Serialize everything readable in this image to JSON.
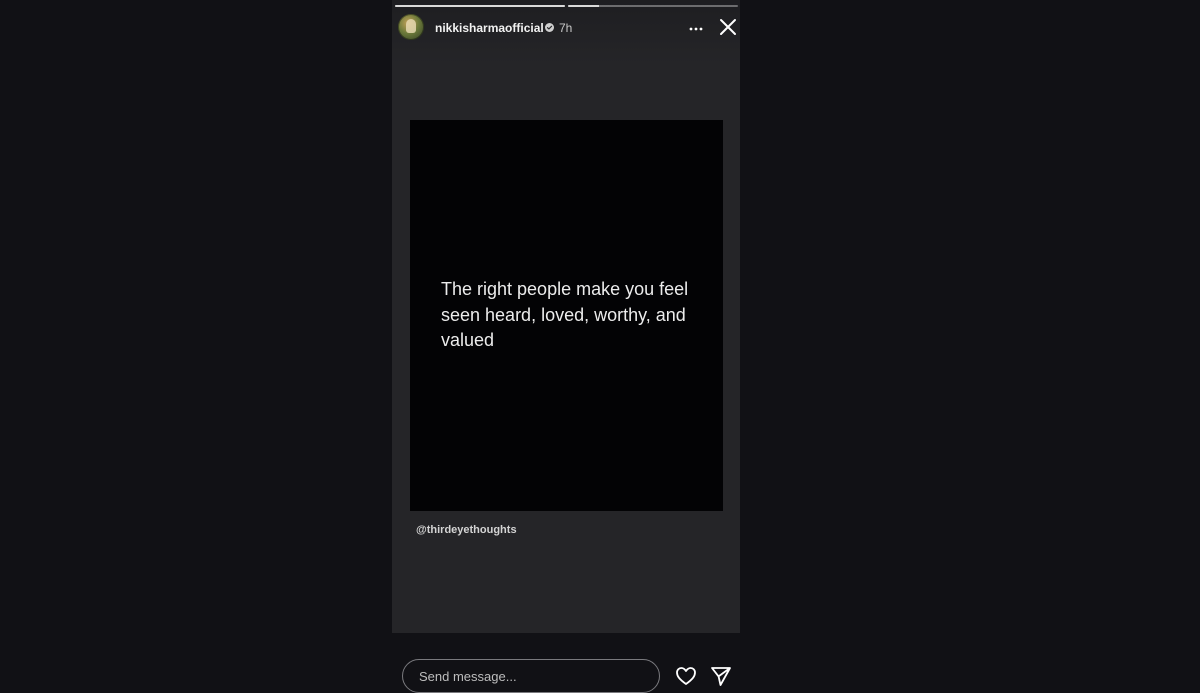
{
  "story": {
    "progress": [
      1.0,
      0.18
    ],
    "username": "nikkisharmaofficial",
    "time": "7h",
    "verified": true,
    "quote": "The right people make you feel seen heard, loved, worthy, and valued",
    "mention": "@thirdeyethoughts"
  },
  "reply": {
    "placeholder": "Send message..."
  },
  "icons": {
    "avatar": "avatar",
    "verified": "verified-badge-icon",
    "more": "more-options-icon",
    "close": "close-icon",
    "heart": "heart-icon",
    "send": "send-icon"
  },
  "colors": {
    "background": "#111115",
    "story_background": "#252528",
    "card_background": "#030305",
    "text": "#ececec"
  }
}
